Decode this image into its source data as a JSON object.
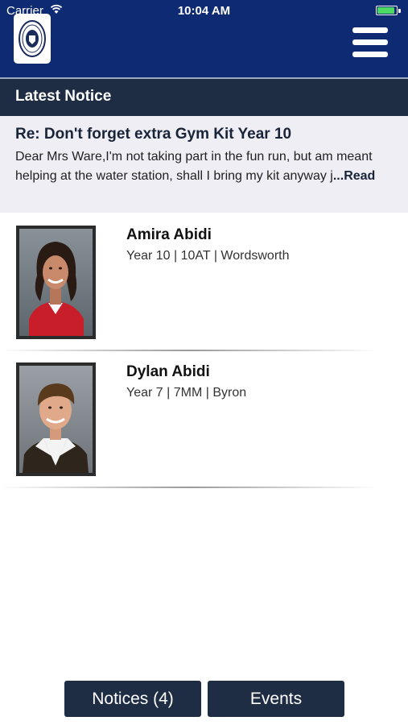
{
  "status_bar": {
    "carrier": "Carrier",
    "time": "10:04 AM",
    "battery_color": "#4cd964"
  },
  "header": {
    "background": "#0e2a73",
    "logo_icon": "school-crest-icon",
    "menu_icon": "hamburger-menu-icon"
  },
  "latest_notice": {
    "heading": "Latest Notice",
    "title": "Re: Don't forget extra Gym Kit Year 10",
    "body_line1": "Dear Mrs Ware,I'm not taking part in the fun run, but am meant",
    "body_line2": "helping at the water station, shall I bring my kit anyway j",
    "read_more": "...Read"
  },
  "students": [
    {
      "name": "Amira Abidi",
      "details": "Year 10 | 10AT | Wordsworth"
    },
    {
      "name": "Dylan Abidi",
      "details": "Year 7 | 7MM | Byron"
    }
  ],
  "bottom_nav": {
    "notices_label": "Notices (4)",
    "events_label": "Events"
  }
}
